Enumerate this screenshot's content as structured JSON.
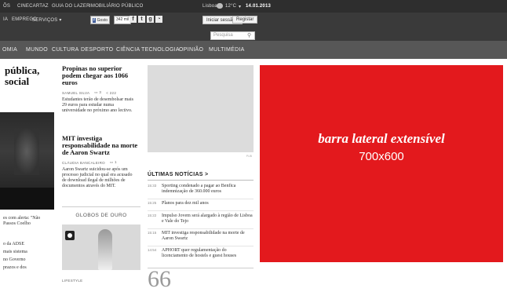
{
  "topbar": {
    "links": [
      "ÕS",
      "CINECARTAZ",
      "GUIA DO LAZER",
      "IMOBILIÁRIO PÚBLICO"
    ],
    "weather": "Lisboa",
    "temp": "12°C",
    "date": "14.01.2013"
  },
  "subbar": {
    "menu": [
      "IA",
      "EMPREGO",
      "SERVIÇOS ▾"
    ],
    "facebook_label": "Gosto",
    "facebook_count": "342 mil",
    "login_label": "Iniciar sessão ▾",
    "register_label": "Registar",
    "search_placeholder": "Pesquisa"
  },
  "nav": {
    "items": [
      "OMIA",
      "MUNDO",
      "CULTURA",
      "DESPORTO",
      "CIÊNCIA",
      "TECNOLOGIA",
      "OPINIÃO",
      "MULTIMÉDIA"
    ]
  },
  "left": {
    "headline": "pública,\nsocial",
    "story_a": "es com alerta: \"Não\n Passos Coelho",
    "story_b": "o da ADSE\nmais sistema\nno Governo\n prazos e dos"
  },
  "col2": {
    "article1": {
      "headline": "Propinas no superior podem chegar aos 1066 euros",
      "author": "SAMUEL SILVA",
      "comments": "3",
      "shares": "222",
      "body": "Estudantes terão de desembolsar mais 29 euros para estudar numa universidade no próximo ano lectivo."
    },
    "article2": {
      "headline": "MIT investiga responsabilidade na morte de Aaron Swartz",
      "author": "CLÁUDIA BANCALEIRO",
      "comments": "1",
      "body": "Aaron Swartz suicidou-se após um processo judicial no qual era acusado de download ilegal de milhões de documentos através do MIT."
    },
    "section_label": "GLOBOS DE OURO",
    "bottom_meta": "LIFESTYLE"
  },
  "col3": {
    "latest_title": "ÚLTIMAS NOTÍCIAS >",
    "items": [
      {
        "time": "15:33",
        "text": "Sporting condenado a pagar ao Benfica indemnização de 360.000 euros"
      },
      {
        "time": "15:25",
        "text": "Planos para dez mil anos"
      },
      {
        "time": "15:22",
        "text": "Impulso Jovem será alargado à região de Lisboa e Vale do Tejo"
      },
      {
        "time": "15:15",
        "text": "MIT investiga responsabilidade na morte de Aaron Swartz"
      },
      {
        "time": "14:54",
        "text": "APHORT quer regulamentação do licenciamento de hostels e guest houses"
      }
    ],
    "quote_mark": "66"
  },
  "ad": {
    "line1": "barra lateral extensível",
    "line2": "700x600",
    "color": "#e3191d"
  }
}
